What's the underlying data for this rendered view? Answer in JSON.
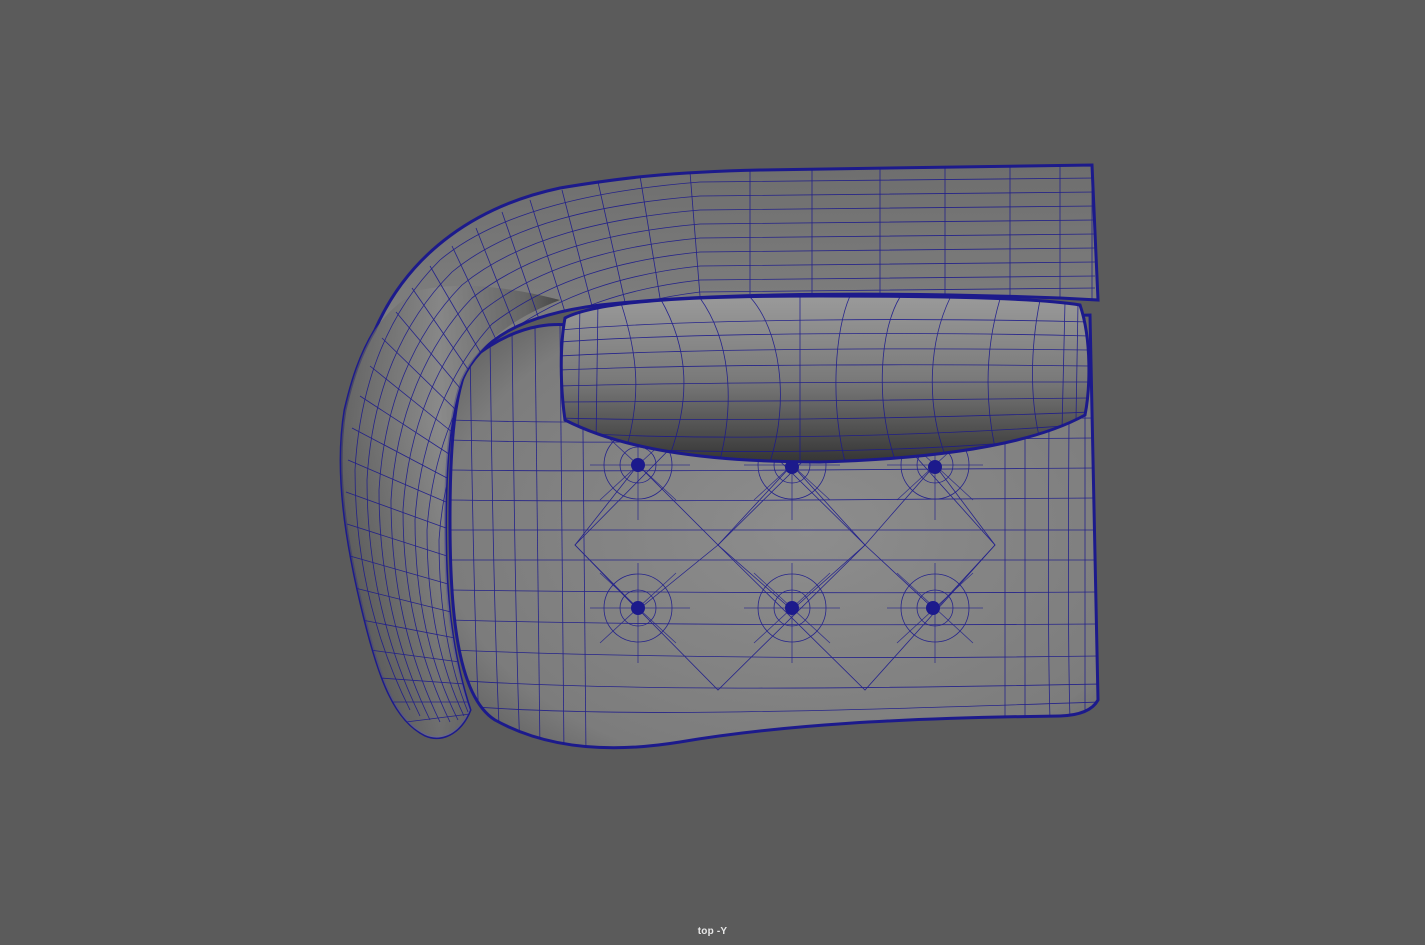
{
  "viewport": {
    "camera_label": "top -Y",
    "background_color": "#5b5b5b",
    "wireframe_color": "#1c1a8c",
    "shaded_color": "#7b7b7b"
  },
  "scene": {
    "object": "sofa-chaise-wireframe",
    "tufting_buttons": 6
  }
}
